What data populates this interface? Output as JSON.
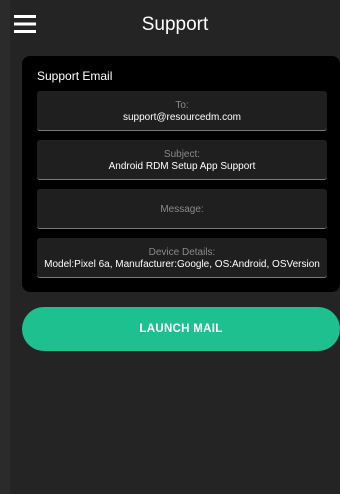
{
  "header": {
    "title": "Support",
    "menu_icon": "hamburger-menu-icon"
  },
  "support_email": {
    "title": "Support Email",
    "fields": [
      {
        "label": "To:",
        "value": "support@resourcedm.com"
      },
      {
        "label": "Subject:",
        "value": "Android RDM Setup App Support"
      },
      {
        "label": "Message:",
        "value": ""
      },
      {
        "label": "Device Details:",
        "value": "Model:Pixel 6a, Manufacturer:Google, OS:Android, OSVersion"
      }
    ]
  },
  "actions": {
    "launch_label": "LAUNCH MAIL"
  },
  "colors": {
    "background": "#242424",
    "card": "#000000",
    "field": "#1f1f1f",
    "accent": "#1fc08f"
  }
}
